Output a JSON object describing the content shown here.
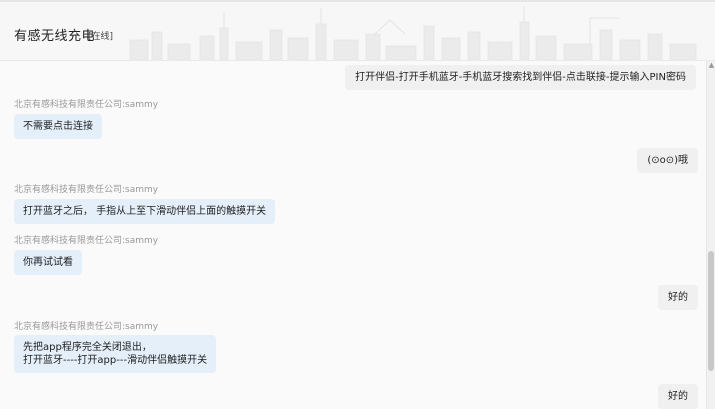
{
  "header": {
    "title": "有感无线充电",
    "status": "[在线]"
  },
  "colors": {
    "incoming_bubble": "#e4effa",
    "outgoing_bubble": "#f0f0f0",
    "sender_text": "#999999"
  },
  "messages": [
    {
      "direction": "out",
      "text": "打开伴侣-打开手机蓝牙-手机蓝牙搜索找到伴侣-点击联接-提示输入PIN密码"
    },
    {
      "direction": "in",
      "sender": "北京有感科技有限责任公司:sammy",
      "text": "不需要点击连接"
    },
    {
      "direction": "out",
      "text": "(⊙o⊙)哦"
    },
    {
      "direction": "in",
      "sender": "北京有感科技有限责任公司:sammy",
      "text": "打开蓝牙之后， 手指从上至下滑动伴侣上面的触摸开关"
    },
    {
      "direction": "in",
      "sender": "北京有感科技有限责任公司:sammy",
      "text": "你再试试看"
    },
    {
      "direction": "out",
      "text": "好的"
    },
    {
      "direction": "in",
      "sender": "北京有感科技有限责任公司:sammy",
      "lines": [
        "先把app程序完全关闭退出，",
        "打开蓝牙----打开app---滑动伴侣触摸开关"
      ]
    },
    {
      "direction": "out",
      "text": "好的"
    }
  ],
  "icons": {
    "scroll_up": "scroll-up-arrow-icon"
  }
}
